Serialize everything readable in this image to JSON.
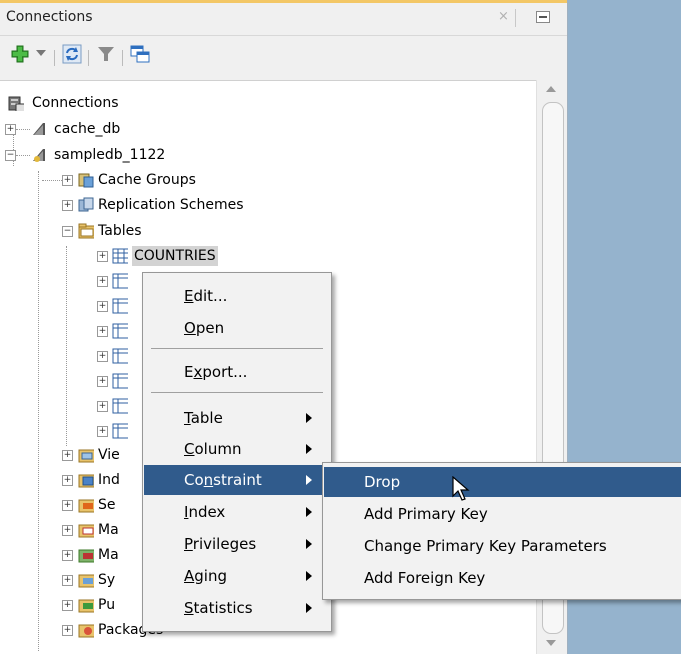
{
  "panel": {
    "title": "Connections",
    "close_glyph": "×"
  },
  "toolbar": {
    "buttons": [
      {
        "name": "new-connection-icon"
      },
      {
        "name": "dropdown-arrow-icon"
      },
      {
        "name": "refresh-icon"
      },
      {
        "name": "filter-icon"
      },
      {
        "name": "schema-browser-icon"
      }
    ]
  },
  "tree": {
    "root": "Connections",
    "cache_db": "cache_db",
    "sampledb": "sampledb_1122",
    "cache_groups": "Cache Groups",
    "replication_schemes": "Replication Schemes",
    "tables": "Tables",
    "countries": "COUNTRIES",
    "vie": "Vie",
    "ind": "Ind",
    "se": "Se",
    "ma1": "Ma",
    "ma2": "Ma",
    "sy": "Sy",
    "pu": "Pu",
    "packages": "Packages"
  },
  "context_menu": {
    "items": [
      {
        "label": "Edit...",
        "mnemonic": "E"
      },
      {
        "label": "Open",
        "mnemonic": "O"
      },
      {
        "label": "Export...",
        "mnemonic": "x"
      },
      {
        "label": "Table",
        "mnemonic": "T"
      },
      {
        "label": "Column",
        "mnemonic": "C"
      },
      {
        "label": "Constraint",
        "mnemonic": "n"
      },
      {
        "label": "Index",
        "mnemonic": "I"
      },
      {
        "label": "Privileges",
        "mnemonic": "P"
      },
      {
        "label": "Aging",
        "mnemonic": "A"
      },
      {
        "label": "Statistics",
        "mnemonic": "S"
      }
    ]
  },
  "submenu": {
    "items": [
      {
        "label": "Drop"
      },
      {
        "label": "Add Primary Key"
      },
      {
        "label": "Change Primary Key Parameters"
      },
      {
        "label": "Add Foreign Key"
      }
    ]
  },
  "colors": {
    "highlight": "#305b8c",
    "background": "#95b3cd",
    "accent_strip": "#f3c766"
  }
}
